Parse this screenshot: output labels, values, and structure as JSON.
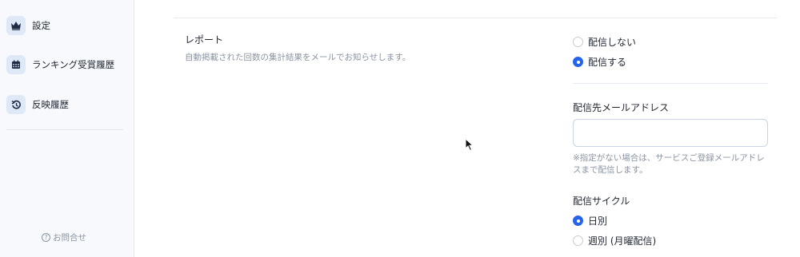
{
  "sidebar": {
    "items": [
      {
        "label": "設定",
        "icon": "crown-icon"
      },
      {
        "label": "ランキング受賞履歴",
        "icon": "calendar-icon"
      },
      {
        "label": "反映履歴",
        "icon": "history-icon"
      }
    ],
    "contact": {
      "icon": "question-icon",
      "icon_char": "?",
      "label": "お問合せ"
    }
  },
  "report": {
    "title": "レポート",
    "description": "自動掲載された回数の集計結果をメールでお知らせします。",
    "options": [
      {
        "label": "配信しない",
        "selected": false
      },
      {
        "label": "配信する",
        "selected": true
      }
    ]
  },
  "email": {
    "label": "配信先メールアドレス",
    "value": "",
    "placeholder": "",
    "note": "※指定がない場合は、サービスご登録メールアドレスまで配信します。"
  },
  "cycle": {
    "label": "配信サイクル",
    "options": [
      {
        "label": "日別",
        "selected": true
      },
      {
        "label": "週別 (月曜配信)",
        "selected": false
      }
    ]
  },
  "colors": {
    "accent": "#2563eb",
    "sidebar_bg": "#f7f9fc",
    "icon_bg": "#dfe8f6",
    "muted_text": "#8a94a2"
  }
}
